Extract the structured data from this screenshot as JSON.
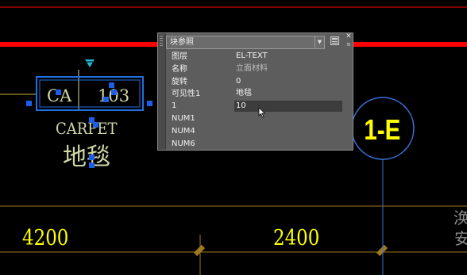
{
  "colors": {
    "background": "#000000",
    "red_line": "#ff0000",
    "yellow": "#ffff00",
    "selection_blue": "#1f6fe0",
    "grip_blue": "#1e5ee6",
    "axis_blue": "#3a6fd8",
    "dim_tick": "#a07820",
    "cream_text": "#cfd9a6",
    "cyan_arrow": "#23b7d6"
  },
  "drawing": {
    "tag_left": "CA",
    "tag_right": "103",
    "label_en": "CARPET",
    "label_cn": "地毯",
    "grid_bubble": "1-E",
    "dim_left": "4200",
    "dim_mid": "2400",
    "edge_text_top": "涣",
    "edge_text_bottom": "安"
  },
  "properties": {
    "selector": "块参照",
    "rows": [
      {
        "label": "图层",
        "value": "EL-TEXT"
      },
      {
        "label": "名称",
        "value": "立面材料"
      },
      {
        "label": "旋转",
        "value": "0"
      },
      {
        "label": "可见性1",
        "value": "地毯"
      },
      {
        "label": "1",
        "value": "10"
      },
      {
        "label": "NUM1",
        "value": ""
      },
      {
        "label": "NUM4",
        "value": ""
      },
      {
        "label": "NUM6",
        "value": ""
      }
    ],
    "icons": {
      "quick_select": "quick-select-icon",
      "close": "close-icon",
      "options": "options-icon",
      "dropdown": "chevron-down-icon"
    }
  }
}
